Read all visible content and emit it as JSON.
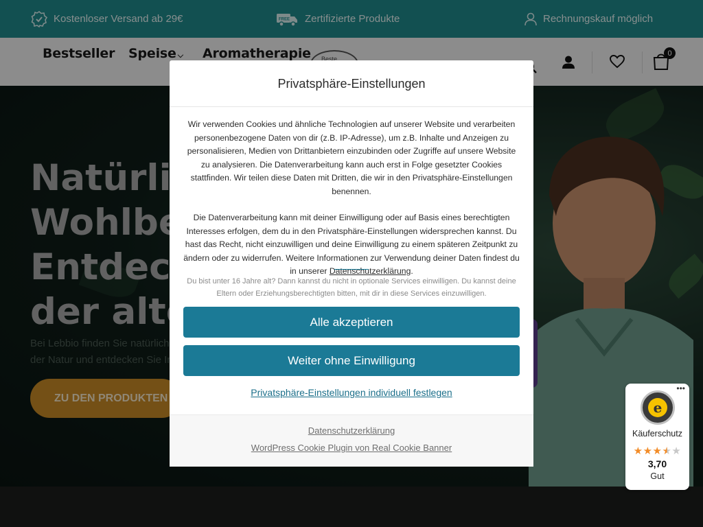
{
  "topbar": {
    "shipping": "Kostenloser Versand ab 29€",
    "certified": "Zertifizierte Produkte",
    "invoice": "Rechnungskauf möglich",
    "free_badge": "FREE"
  },
  "nav": {
    "items": [
      {
        "label": "Bestseller"
      },
      {
        "label": "Speise"
      },
      {
        "label": "Aromatherapie"
      }
    ],
    "logo_text": "Beste",
    "cart_count": "0",
    "icons": [
      "search-icon",
      "user-icon",
      "heart-icon",
      "cart-icon"
    ]
  },
  "hero": {
    "title_lines": [
      "Natürlic",
      "Wohlbe",
      "Entdeck",
      "der alte"
    ],
    "subtitle_lines": [
      "Bei Lebbio finden Sie natürliche",
      "der Natur und entdecken Sie In"
    ],
    "cta": "ZU DEN PRODUKTEN"
  },
  "cookie_modal": {
    "title": "Privatsphäre-Einstellungen",
    "paragraph1": "Wir verwenden Cookies und ähnliche Technologien auf unserer Website und verarbeiten personenbezogene Daten von dir (z.B. IP-Adresse), um z.B. Inhalte und Anzeigen zu personalisieren, Medien von Drittanbietern einzubinden oder Zugriffe auf unsere Website zu analysieren. Die Datenverarbeitung kann auch erst in Folge gesetzter Cookies stattfinden. Wir teilen diese Daten mit Dritten, die wir in den Privatsphäre-Einstellungen benennen.",
    "paragraph2_text": "Die Datenverarbeitung kann mit deiner Einwilligung oder auf Basis eines berechtigten Interesses erfolgen, dem du in den Privatsphäre-Einstellungen widersprechen kannst. Du hast das Recht, nicht einzuwilligen und deine Einwilligung zu einem späteren Zeitpunkt zu ändern oder zu widerrufen. Weitere Informationen zur Verwendung deiner Daten findest du in unserer",
    "paragraph2_link": "Datenschutzerklärung",
    "paragraph2_end": ".",
    "minor_notice": "Du bist unter 16 Jahre alt? Dann kannst du nicht in optionale Services einwilligen. Du kannst deine Eltern oder Erziehungsberechtigten bitten, mit dir in diese Services einzuwilligen.",
    "accept_all": "Alle akzeptieren",
    "continue_without": "Weiter ohne Einwilligung",
    "individual_settings": "Privatsphäre-Einstellungen individuell festlegen",
    "footer_privacy": "Datenschutzerklärung",
    "footer_plugin": "WordPress Cookie Plugin von Real Cookie Banner"
  },
  "trusted_shops": {
    "label": "Käuferschutz",
    "rating": "3,70",
    "grade": "Gut",
    "stars_filled": 3.5,
    "stars_total": 5,
    "star_color": "#f28c28",
    "seal_letter": "e",
    "seal_ring_text": "TRUSTED SHOPS GUARANTEE",
    "menu": "•••"
  },
  "colors": {
    "topbar": "#1f8a8c",
    "primary_button": "#1b7a96",
    "cta": "#c98a26"
  }
}
